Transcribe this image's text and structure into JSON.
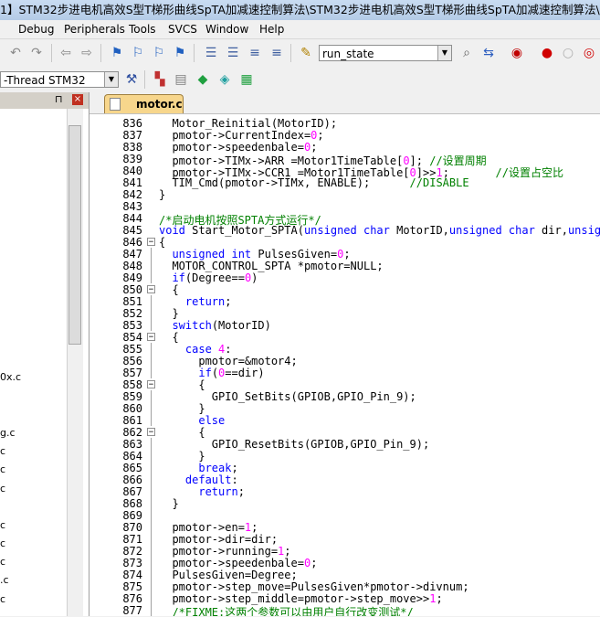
{
  "window": {
    "title": "1】STM32步进电机高效S型T梯形曲线SpTA加减速控制算法\\STM32步进电机高效S型T梯形曲线SpTA加减速控制算法\\STM"
  },
  "menu": [
    "Debug",
    "Peripherals",
    "Tools",
    "SVCS",
    "Window",
    "Help"
  ],
  "toolbar": {
    "find_value": "run_state",
    "target_value": "-Thread STM32"
  },
  "icons": [
    "undo-icon",
    "redo-icon",
    "nav-back-icon",
    "nav-forward-icon",
    "bookmark-icon",
    "bookmark-prev-icon",
    "bookmark-next-icon",
    "bookmark-clear-icon",
    "indent-icon",
    "unindent-icon",
    "comment-icon",
    "uncomment-icon",
    "find-in-files-icon",
    "debug-icon",
    "breakpoint-icon",
    "breakpoint-disable-icon",
    "target-options-icon",
    "manage-components-icon",
    "rte-icon",
    "pack-installer-icon"
  ],
  "left_panel": {
    "files": [
      "0x.c",
      "g.c",
      "c",
      "c",
      "c",
      "c",
      "c",
      "c",
      ".c",
      "c"
    ]
  },
  "editor": {
    "tab_label": "motor.c",
    "lines": [
      {
        "n": "836",
        "segs": [
          [
            "",
            "  Motor_Reinitial(MotorID);"
          ]
        ]
      },
      {
        "n": "837",
        "segs": [
          [
            "",
            "  pmotor->CurrentIndex="
          ],
          [
            "num",
            "0"
          ],
          [
            "",
            ";"
          ]
        ]
      },
      {
        "n": "838",
        "segs": [
          [
            "",
            "  pmotor->speedenbale="
          ],
          [
            "num",
            "0"
          ],
          [
            "",
            ";"
          ]
        ]
      },
      {
        "n": "839",
        "segs": [
          [
            "",
            "  pmotor->TIMx->ARR =Motor1TimeTable["
          ],
          [
            "num",
            "0"
          ],
          [
            "",
            "]; "
          ],
          [
            "cm",
            "//设置周期"
          ]
        ]
      },
      {
        "n": "840",
        "segs": [
          [
            "",
            "  pmotor->TIMx->CCR1 =Motor1TimeTable["
          ],
          [
            "num",
            "0"
          ],
          [
            "",
            "]>>"
          ],
          [
            "num",
            "1"
          ],
          [
            "",
            ";       "
          ],
          [
            "cm",
            "//设置占空比"
          ]
        ]
      },
      {
        "n": "841",
        "segs": [
          [
            "",
            "  TIM_Cmd(pmotor->TIMx, ENABLE);      "
          ],
          [
            "cm",
            "//DISABLE"
          ]
        ]
      },
      {
        "n": "842",
        "segs": [
          [
            "",
            "}"
          ]
        ]
      },
      {
        "n": "843",
        "segs": [
          [
            "",
            ""
          ]
        ]
      },
      {
        "n": "844",
        "segs": [
          [
            "cm",
            "/*启动电机按照SPTA方式运行*/"
          ]
        ]
      },
      {
        "n": "845",
        "segs": [
          [
            "kw",
            "void"
          ],
          [
            "",
            " Start_Motor_SPTA("
          ],
          [
            "kw",
            "unsigned char"
          ],
          [
            "",
            " MotorID,"
          ],
          [
            "kw",
            "unsigned char"
          ],
          [
            "",
            " dir,"
          ],
          [
            "kw",
            "unsigne"
          ]
        ]
      },
      {
        "n": "846",
        "segs": [
          [
            "",
            "{"
          ]
        ]
      },
      {
        "n": "847",
        "segs": [
          [
            "",
            "  "
          ],
          [
            "kw",
            "unsigned int"
          ],
          [
            "",
            " PulsesGiven="
          ],
          [
            "num",
            "0"
          ],
          [
            "",
            ";"
          ]
        ]
      },
      {
        "n": "848",
        "segs": [
          [
            "",
            "  MOTOR_CONTROL_SPTA *pmotor=NULL;"
          ]
        ]
      },
      {
        "n": "849",
        "segs": [
          [
            "",
            "  "
          ],
          [
            "kw",
            "if"
          ],
          [
            "",
            "(Degree=="
          ],
          [
            "num",
            "0"
          ],
          [
            "",
            ")"
          ]
        ]
      },
      {
        "n": "850",
        "segs": [
          [
            "",
            "  {"
          ]
        ]
      },
      {
        "n": "851",
        "segs": [
          [
            "",
            "    "
          ],
          [
            "kw",
            "return"
          ],
          [
            "",
            ";"
          ]
        ]
      },
      {
        "n": "852",
        "segs": [
          [
            "",
            "  }"
          ]
        ]
      },
      {
        "n": "853",
        "segs": [
          [
            "",
            "  "
          ],
          [
            "kw",
            "switch"
          ],
          [
            "",
            "(MotorID)"
          ]
        ]
      },
      {
        "n": "854",
        "segs": [
          [
            "",
            "  {"
          ]
        ]
      },
      {
        "n": "855",
        "segs": [
          [
            "",
            "    "
          ],
          [
            "kw",
            "case"
          ],
          [
            "",
            " "
          ],
          [
            "num",
            "4"
          ],
          [
            "",
            ":"
          ]
        ]
      },
      {
        "n": "856",
        "segs": [
          [
            "",
            "      pmotor=&motor4;"
          ]
        ]
      },
      {
        "n": "857",
        "segs": [
          [
            "",
            "      "
          ],
          [
            "kw",
            "if"
          ],
          [
            "",
            "("
          ],
          [
            "num",
            "0"
          ],
          [
            "",
            "==dir)"
          ]
        ]
      },
      {
        "n": "858",
        "segs": [
          [
            "",
            "      {"
          ]
        ]
      },
      {
        "n": "859",
        "segs": [
          [
            "",
            "        GPIO_SetBits(GPIOB,GPIO_Pin_9);"
          ]
        ]
      },
      {
        "n": "860",
        "segs": [
          [
            "",
            "      }"
          ]
        ]
      },
      {
        "n": "861",
        "segs": [
          [
            "",
            "      "
          ],
          [
            "kw",
            "else"
          ]
        ]
      },
      {
        "n": "862",
        "segs": [
          [
            "",
            "      {"
          ]
        ]
      },
      {
        "n": "863",
        "segs": [
          [
            "",
            "        GPIO_ResetBits(GPIOB,GPIO_Pin_9);"
          ]
        ]
      },
      {
        "n": "864",
        "segs": [
          [
            "",
            "      }"
          ]
        ]
      },
      {
        "n": "865",
        "segs": [
          [
            "",
            "      "
          ],
          [
            "kw",
            "break"
          ],
          [
            "",
            ";"
          ]
        ]
      },
      {
        "n": "866",
        "segs": [
          [
            "",
            "    "
          ],
          [
            "kw",
            "default"
          ],
          [
            "",
            ":"
          ]
        ]
      },
      {
        "n": "867",
        "segs": [
          [
            "",
            "      "
          ],
          [
            "kw",
            "return"
          ],
          [
            "",
            ";"
          ]
        ]
      },
      {
        "n": "868",
        "segs": [
          [
            "",
            "  }"
          ]
        ]
      },
      {
        "n": "869",
        "segs": [
          [
            "",
            ""
          ]
        ]
      },
      {
        "n": "870",
        "segs": [
          [
            "",
            "  pmotor->en="
          ],
          [
            "num",
            "1"
          ],
          [
            "",
            ";"
          ]
        ]
      },
      {
        "n": "871",
        "segs": [
          [
            "",
            "  pmotor->dir=dir;"
          ]
        ]
      },
      {
        "n": "872",
        "segs": [
          [
            "",
            "  pmotor->running="
          ],
          [
            "num",
            "1"
          ],
          [
            "",
            ";"
          ]
        ]
      },
      {
        "n": "873",
        "segs": [
          [
            "",
            "  pmotor->speedenbale="
          ],
          [
            "num",
            "0"
          ],
          [
            "",
            ";"
          ]
        ]
      },
      {
        "n": "874",
        "segs": [
          [
            "",
            "  PulsesGiven=Degree;"
          ]
        ]
      },
      {
        "n": "875",
        "segs": [
          [
            "",
            "  pmotor->step_move=PulsesGiven*pmotor->divnum;"
          ]
        ]
      },
      {
        "n": "876",
        "segs": [
          [
            "",
            "  pmotor->step_middle=pmotor->step_move>>"
          ],
          [
            "num",
            "1"
          ],
          [
            "",
            ";"
          ]
        ]
      },
      {
        "n": "877",
        "segs": [
          [
            "",
            "  "
          ],
          [
            "cm",
            "/*FIXME:这两个参数可以由用户自行改变测试*/"
          ]
        ]
      }
    ]
  }
}
